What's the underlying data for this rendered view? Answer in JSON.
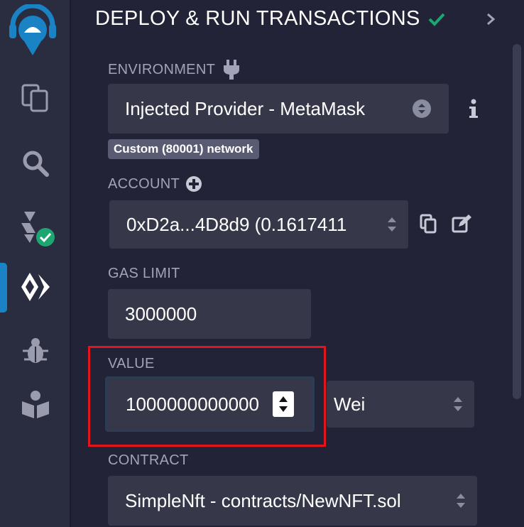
{
  "header": {
    "title": "DEPLOY & RUN TRANSACTIONS"
  },
  "environment": {
    "label": "ENVIRONMENT",
    "value": "Injected Provider - MetaMask",
    "network_badge": "Custom (80001) network"
  },
  "account": {
    "label": "ACCOUNT",
    "value": "0xD2a...4D8d9 (0.1617411"
  },
  "gas_limit": {
    "label": "GAS LIMIT",
    "value": "3000000"
  },
  "value": {
    "label": "VALUE",
    "amount": "1000000000000",
    "unit": "Wei"
  },
  "contract": {
    "label": "CONTRACT",
    "value": "SimpleNft - contracts/NewNFT.sol"
  },
  "colors": {
    "background": "#222336",
    "input": "#363849",
    "success": "#1ea672",
    "active_accent": "#1a83c6",
    "highlight": "#e3141c"
  },
  "icons": {
    "rail": [
      "remix-logo-icon",
      "file-explorer-icon",
      "search-icon",
      "solidity-compiler-icon",
      "deploy-run-icon",
      "debugger-icon",
      "learneth-icon"
    ],
    "panel": [
      "check-icon",
      "chevron-right-icon",
      "plug-icon",
      "info-icon",
      "plus-circle-icon",
      "copy-icon",
      "edit-icon",
      "updown-icon"
    ]
  }
}
